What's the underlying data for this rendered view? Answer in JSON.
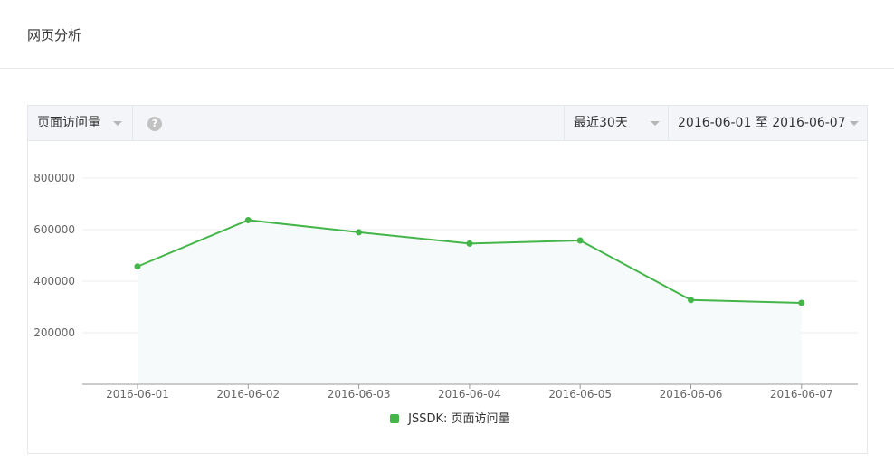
{
  "page": {
    "title": "网页分析"
  },
  "toolbar": {
    "metric_label": "页面访问量",
    "help_icon": "question-circle-icon",
    "help_glyph": "?",
    "range_label": "最近30天",
    "date_range_label": "2016-06-01 至 2016-06-07"
  },
  "colors": {
    "series": "#44b549",
    "area": "#f6fafb",
    "grid": "#eeeeee",
    "axis": "#999999"
  },
  "chart_data": {
    "type": "line",
    "title": "",
    "xlabel": "",
    "ylabel": "",
    "categories": [
      "2016-06-01",
      "2016-06-02",
      "2016-06-03",
      "2016-06-04",
      "2016-06-05",
      "2016-06-06",
      "2016-06-07"
    ],
    "series": [
      {
        "name": "JSSDK: 页面访问量",
        "values": [
          457000,
          637000,
          590000,
          546000,
          558000,
          327000,
          316000
        ]
      }
    ],
    "yticks": [
      200000,
      400000,
      600000,
      800000
    ],
    "ylim": [
      0,
      900000
    ],
    "grid": true,
    "legend": "bottom-center",
    "area_fill": true
  }
}
